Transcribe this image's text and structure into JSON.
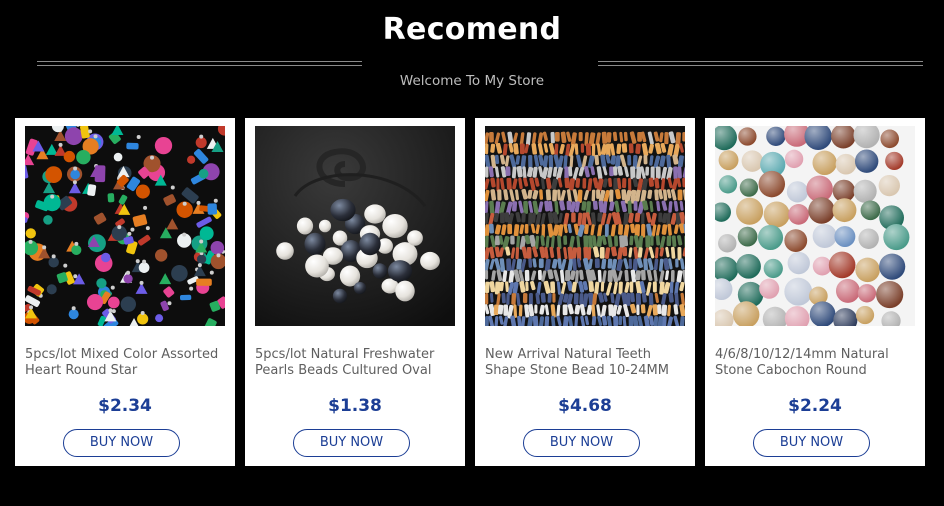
{
  "header": {
    "title": "Recomend",
    "subtitle": "Welcome To My Store"
  },
  "products": [
    {
      "name": "5pcs/lot Mixed Color Assorted Heart Round Star",
      "price": "$2.34",
      "button_label": "BUY NOW",
      "image_icon": "mixed-stone-pendants-image"
    },
    {
      "name": "5pcs/lot Natural Freshwater Pearls Beads Cultured Oval",
      "price": "$1.38",
      "button_label": "BUY NOW",
      "image_icon": "freshwater-pearls-image"
    },
    {
      "name": "New Arrival Natural Teeth Shape Stone Bead 10-24MM",
      "price": "$4.68",
      "button_label": "BUY NOW",
      "image_icon": "stone-bead-strands-image"
    },
    {
      "name": "4/6/8/10/12/14mm Natural Stone Cabochon Round",
      "price": "$2.24",
      "button_label": "BUY NOW",
      "image_icon": "stone-cabochons-image"
    }
  ],
  "colors": {
    "background": "#000000",
    "price": "#1c3e95",
    "button_border": "#1c3e95"
  }
}
